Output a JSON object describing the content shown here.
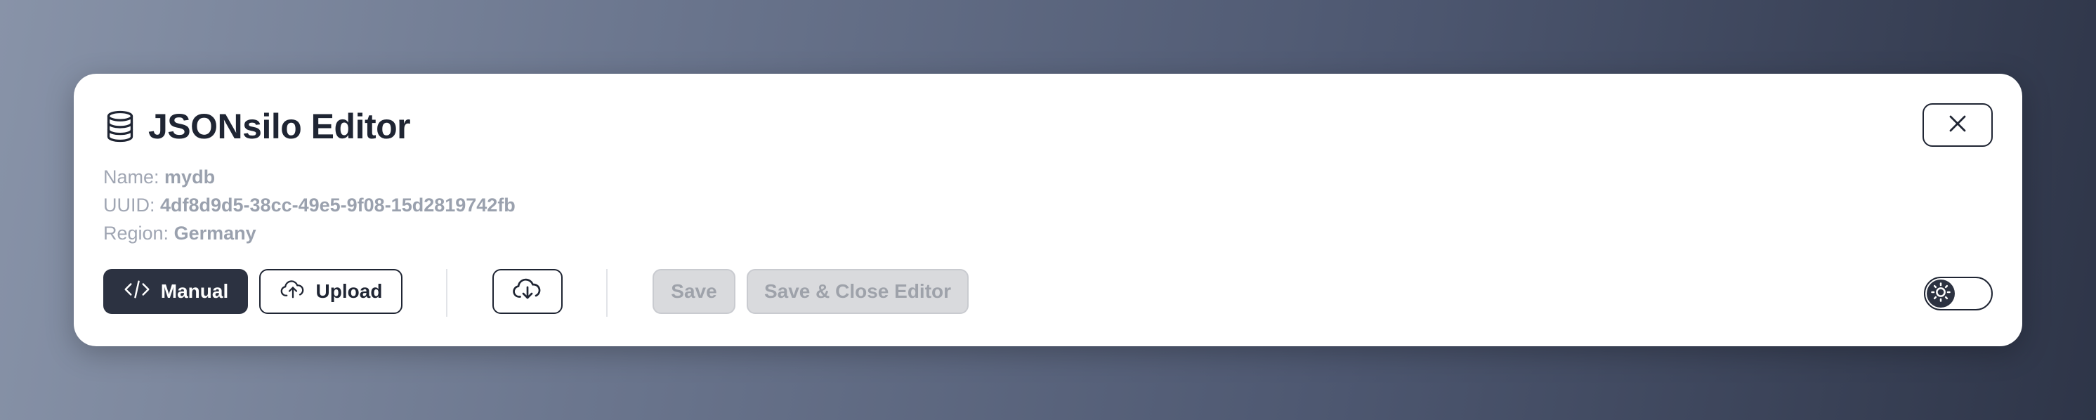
{
  "header": {
    "title": "JSONsilo Editor",
    "icon": "database-icon"
  },
  "meta": {
    "name_label": "Name:",
    "name_value": "mydb",
    "uuid_label": "UUID:",
    "uuid_value": "4df8d9d5-38cc-49e5-9f08-15d2819742fb",
    "region_label": "Region:",
    "region_value": "Germany"
  },
  "toolbar": {
    "manual_label": "Manual",
    "manual_icon": "code-icon",
    "upload_label": "Upload",
    "upload_icon": "cloud-upload-icon",
    "download_icon": "cloud-download-icon",
    "save_label": "Save",
    "save_close_label": "Save & Close Editor"
  },
  "theme_toggle": {
    "icon": "sun-icon"
  },
  "colors": {
    "primary_dark": "#2c3241",
    "disabled_bg": "#d9dadd",
    "disabled_text": "#9ea2aa"
  }
}
